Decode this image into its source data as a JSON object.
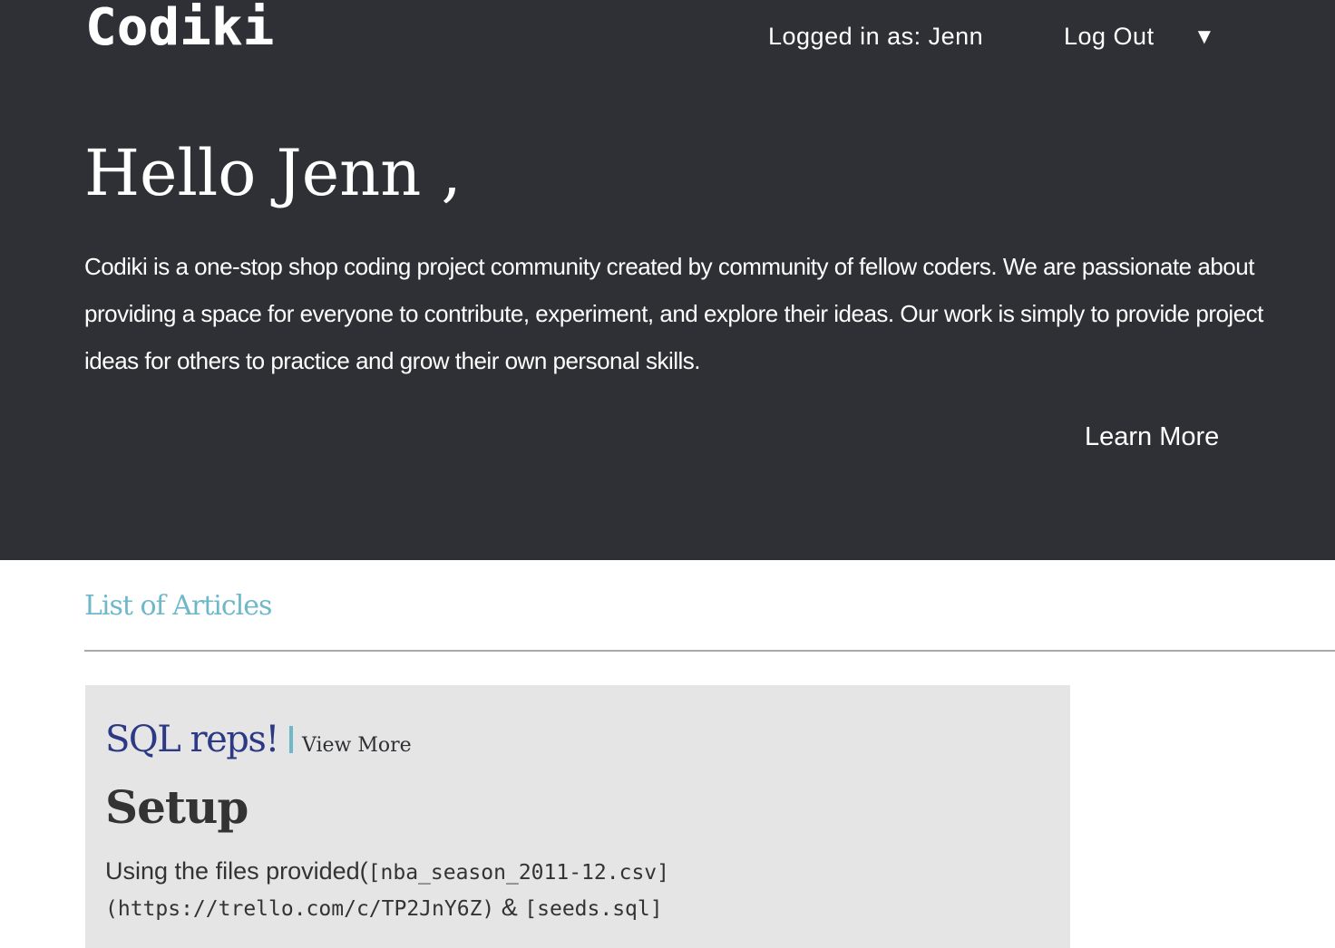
{
  "header": {
    "logo": "Codiki",
    "logged_in_text": "Logged in as: Jenn",
    "logout_label": "Log Out",
    "menu_caret": "▼"
  },
  "hero": {
    "greeting": "Hello Jenn ,",
    "intro": "Codiki is a one-stop shop coding project community created by community of fellow coders. We are passionate about providing a space for everyone to contribute, experiment, and explore their ideas. Our work is simply to provide project ideas for others to practice and grow their own personal skills.",
    "learn_more_label": "Learn More"
  },
  "articles": {
    "section_title": "List of Articles",
    "items": [
      {
        "title": "SQL reps!",
        "view_more_label": "View More",
        "heading": "Setup",
        "body_text_1": "Using the files provided(",
        "body_code_1": "[nba_season_2011-12.csv]",
        "body_code_2": "(https://trello.com/c/TP2JnY6Z)",
        "body_text_2": " & ",
        "body_code_3": "[seeds.sql]"
      }
    ]
  },
  "colors": {
    "header_bg": "#2e3035",
    "section_title": "#6eb8c9",
    "article_title": "#2c3a86",
    "card_bg": "#e5e5e5"
  }
}
